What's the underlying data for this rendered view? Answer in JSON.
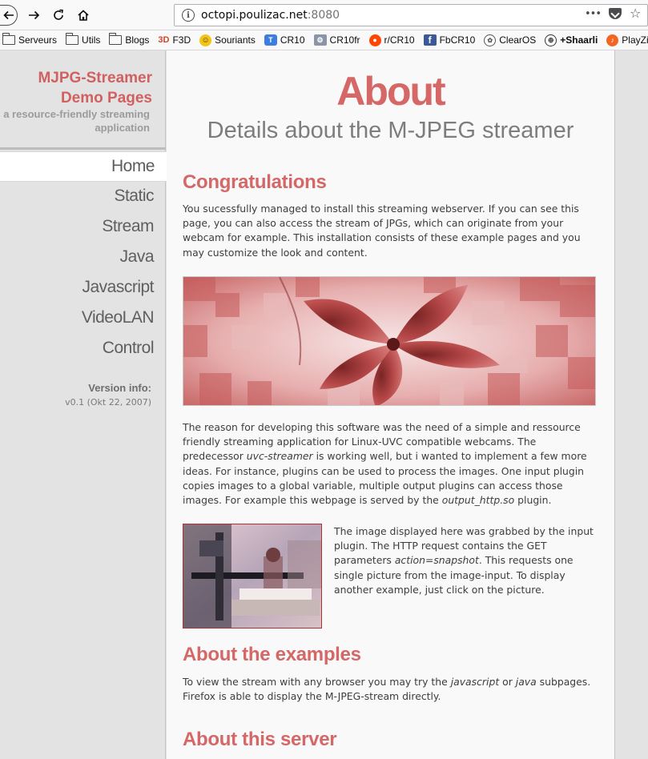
{
  "browser": {
    "url_host": "octopi.poulizac.net",
    "url_port": ":8080",
    "menu_dots": "•••"
  },
  "bookmarks": [
    {
      "label": "Serveurs",
      "icon": "folder-icon"
    },
    {
      "label": "Utils",
      "icon": "folder-icon"
    },
    {
      "label": "Blogs",
      "icon": "folder-icon"
    },
    {
      "label": "F3D",
      "icon": "f3d-icon",
      "badge": "3D"
    },
    {
      "label": "Souriants",
      "icon": "smiley-icon"
    },
    {
      "label": "CR10",
      "icon": "cr10-icon"
    },
    {
      "label": "CR10fr",
      "icon": "cr10fr-icon"
    },
    {
      "label": "r/CR10",
      "icon": "reddit-icon"
    },
    {
      "label": "FbCR10",
      "icon": "facebook-icon"
    },
    {
      "label": "ClearOS",
      "icon": "clearos-icon"
    },
    {
      "label": "+Shaarli",
      "icon": "globe-icon"
    },
    {
      "label": "PlayZic",
      "icon": "playzic-icon"
    }
  ],
  "sidebar": {
    "title_line1": "MJPG-Streamer",
    "title_line2": "Demo Pages",
    "subtitle_line1": "a resource-friendly streaming",
    "subtitle_line2": "application",
    "nav": [
      "Home",
      "Static",
      "Stream",
      "Java",
      "Javascript",
      "VideoLAN",
      "Control"
    ],
    "active": "Home",
    "version_label": "Version info:",
    "version_value": "v0.1 (Okt 22, 2007)"
  },
  "main": {
    "title": "About",
    "subtitle": "Details about the M-JPEG streamer",
    "congrats_heading": "Congratulations",
    "congrats_text": "You sucessfully managed to install this streaming webserver. If you can see this page, you can also access the stream of JPGs, which can originate from your webcam for example. This installation consists of these example pages and you may customize the look and content.",
    "reason_p1": "The reason for developing this software was the need of a simple and ressource friendly streaming application for Linux-UVC compatible webcams. The predecessor ",
    "reason_em1": "uvc-streamer",
    "reason_p2": " is working well, but i wanted to implement a few more ideas. For instance, plugins can be used to process the images. One input plugin copies images to a global variable, multiple output plugins can access those images. For example this webpage is served by the ",
    "reason_em2": "output_http.so",
    "reason_p3": " plugin.",
    "snapshot_p1": "The image displayed here was grabbed by the input plugin. The HTTP request contains the GET parameters ",
    "snapshot_em": "action=snapshot",
    "snapshot_p2": ". This requests one single picture from the image-input. To display another example, just click on the picture.",
    "examples_heading": "About the examples",
    "examples_p1": "To view the stream with any browser you may try the ",
    "examples_em1": "javascript",
    "examples_p2": " or ",
    "examples_em2": "java",
    "examples_p3": " subpages. Firefox is able to display the M-JPEG-stream directly.",
    "server_heading": "About this server"
  },
  "colors": {
    "accent": "#d56767",
    "sidebar_bg": "#e3e3e3",
    "content_bg": "#f9f9f9"
  }
}
